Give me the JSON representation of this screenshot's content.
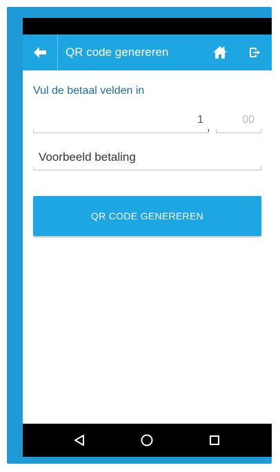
{
  "app_bar": {
    "title": "QR code genereren",
    "back_icon": "arrow-left-icon",
    "home_icon": "home-icon",
    "exit_icon": "logout-icon"
  },
  "form": {
    "heading": "Vul de betaal velden in",
    "amount_integer": "1",
    "amount_separator": ",",
    "amount_decimal_placeholder": "00",
    "description": "Voorbeeld betaling"
  },
  "actions": {
    "generate_label": "QR CODE GENEREREN"
  },
  "nav_bar": {
    "back_icon": "triangle-back-icon",
    "home_icon": "circle-home-icon",
    "recents_icon": "square-recents-icon"
  },
  "colors": {
    "primary": "#1da6e1",
    "frame": "#1e9bd7",
    "heading": "#1a6e9f"
  }
}
